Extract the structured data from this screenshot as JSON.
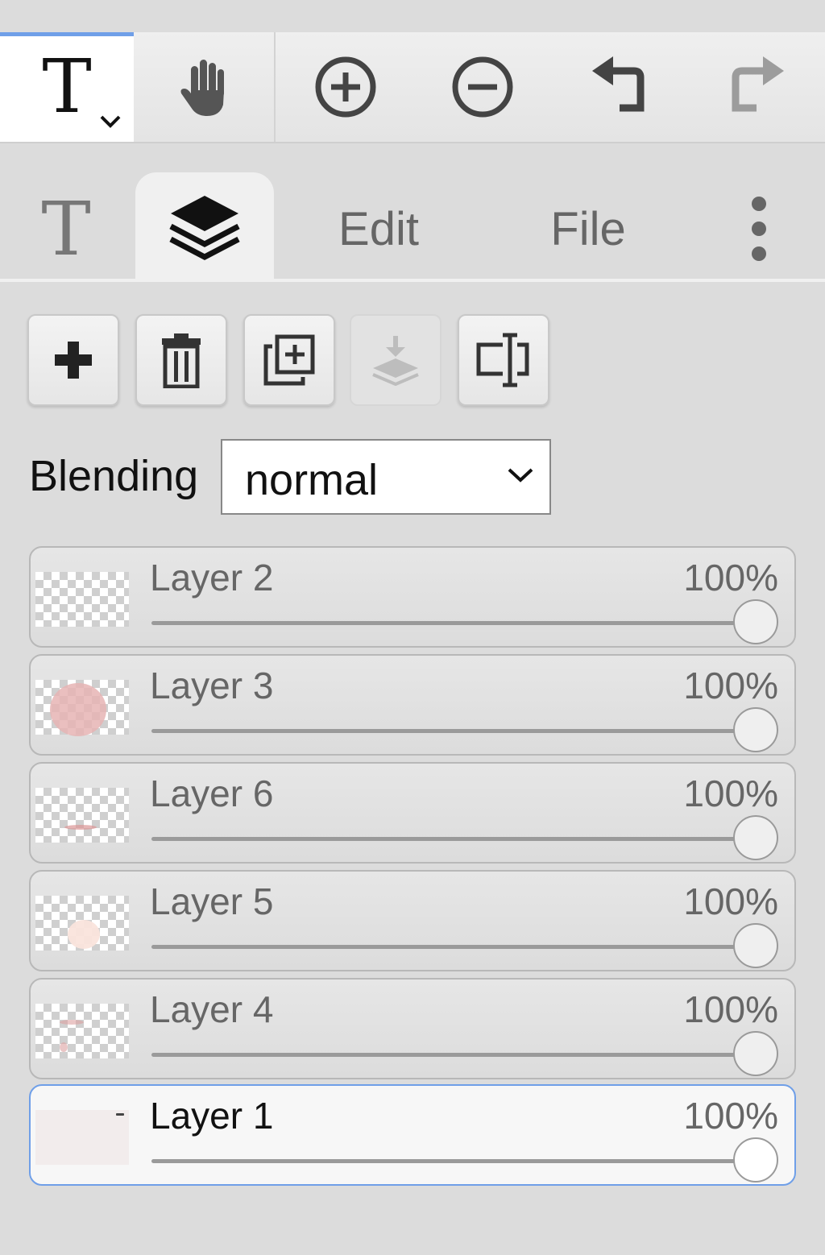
{
  "toolbar": {
    "tools": [
      {
        "name": "text-tool",
        "icon": "text-T-icon",
        "glyph": "T",
        "active": true
      },
      {
        "name": "hand-tool",
        "icon": "hand-icon"
      },
      {
        "name": "zoom-in",
        "icon": "zoom-in-icon"
      },
      {
        "name": "zoom-out",
        "icon": "zoom-out-icon"
      },
      {
        "name": "undo",
        "icon": "undo-icon"
      },
      {
        "name": "redo",
        "icon": "redo-icon",
        "disabled": true
      }
    ]
  },
  "tabs": {
    "text_tab": {
      "glyph": "T",
      "icon": "text-T-icon"
    },
    "layers_tab": {
      "icon": "layers-icon",
      "active": true
    },
    "edit_label": "Edit",
    "file_label": "File",
    "more_icon": "more-vertical-icon"
  },
  "layer_actions": [
    {
      "name": "add-layer-button",
      "icon": "plus-icon"
    },
    {
      "name": "delete-layer-button",
      "icon": "trash-icon"
    },
    {
      "name": "duplicate-layer-button",
      "icon": "duplicate-icon"
    },
    {
      "name": "merge-down-button",
      "icon": "merge-down-icon",
      "disabled": true
    },
    {
      "name": "rename-layer-button",
      "icon": "rename-icon"
    }
  ],
  "blending": {
    "label": "Blending",
    "value": "normal"
  },
  "layers": [
    {
      "name": "Layer 2",
      "opacity": "100%",
      "opacity_value": 1.0,
      "selected": false
    },
    {
      "name": "Layer 3",
      "opacity": "100%",
      "opacity_value": 1.0,
      "selected": false
    },
    {
      "name": "Layer 6",
      "opacity": "100%",
      "opacity_value": 1.0,
      "selected": false
    },
    {
      "name": "Layer 5",
      "opacity": "100%",
      "opacity_value": 1.0,
      "selected": false
    },
    {
      "name": "Layer 4",
      "opacity": "100%",
      "opacity_value": 1.0,
      "selected": false
    },
    {
      "name": "Layer 1",
      "opacity": "100%",
      "opacity_value": 1.0,
      "selected": true
    }
  ],
  "colors": {
    "accent": "#6f9fe8",
    "panel_bg": "#dcdcdc"
  }
}
